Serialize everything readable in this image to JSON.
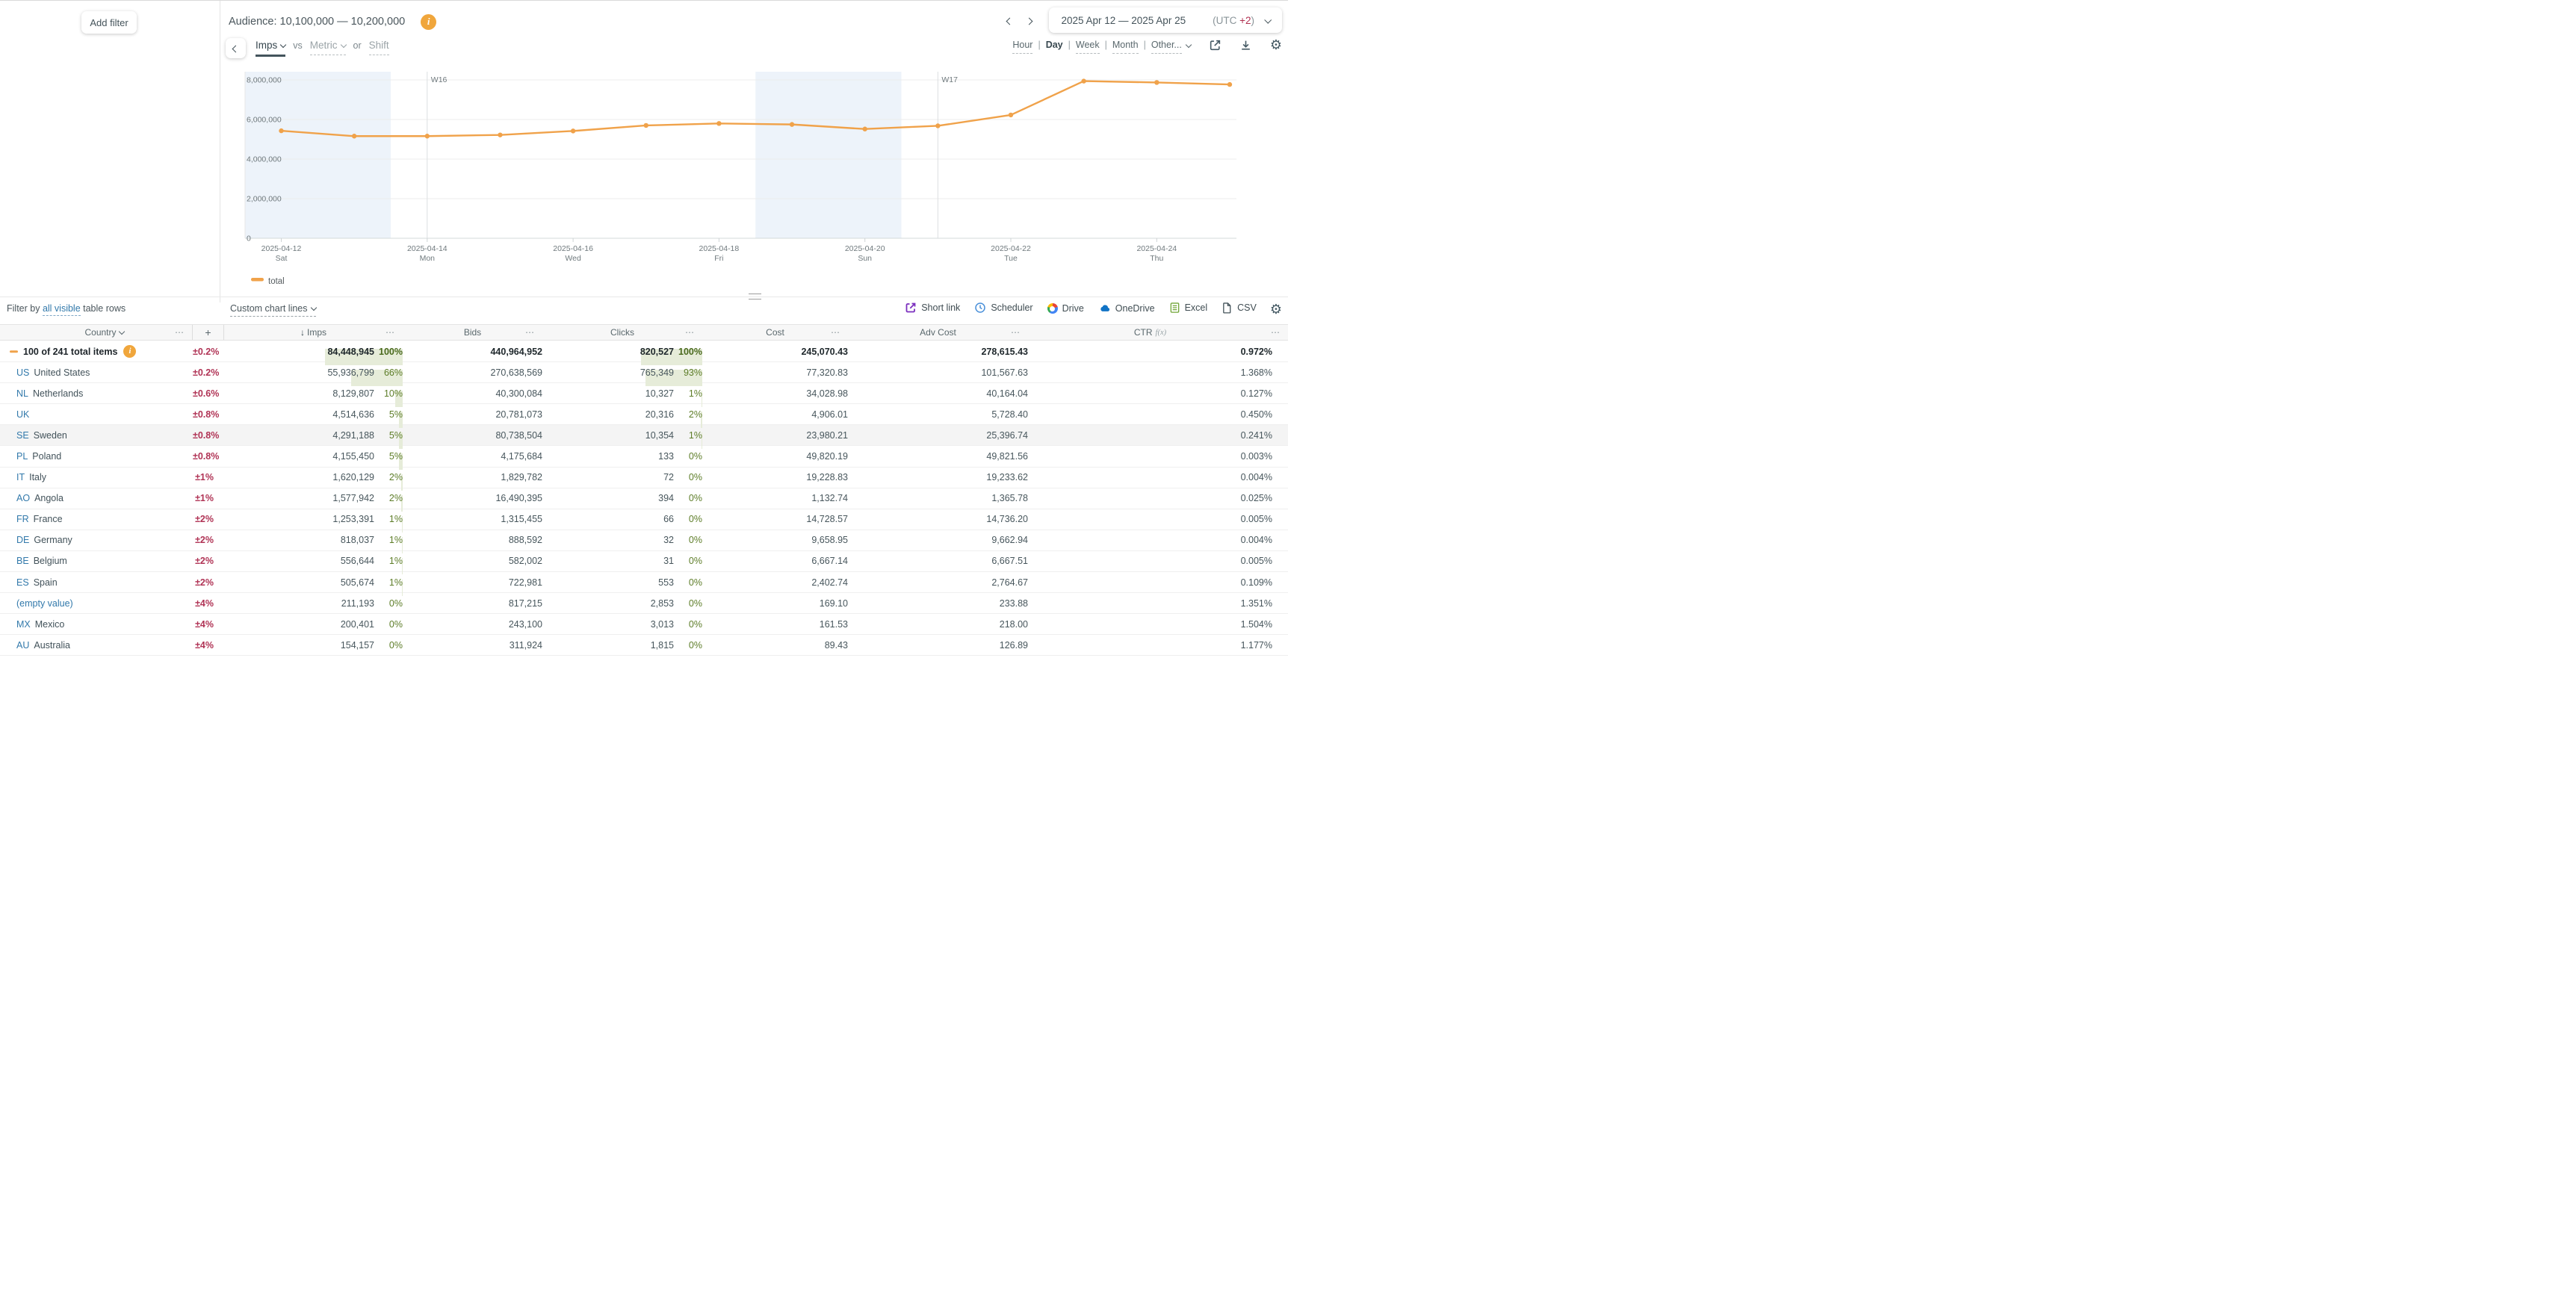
{
  "icons": {
    "ellipsis": "⋯",
    "plus": "+",
    "sort_desc": "↓",
    "gear": "⚙"
  },
  "header": {
    "add_filter_label": "Add filter",
    "audience_label": "Audience: 10,100,000 — 10,200,000",
    "date_range": "2025 Apr 12 — 2025 Apr 25",
    "utc_prefix": "(UTC ",
    "utc_value": "+2",
    "utc_suffix": ")"
  },
  "controls": {
    "primary_metric": "Imps",
    "vs_label": "vs",
    "secondary_metric": "Metric",
    "or_label": "or",
    "shift_label": "Shift",
    "granularities": [
      "Hour",
      "Day",
      "Week",
      "Month",
      "Other..."
    ],
    "selected_granularity": "Day"
  },
  "chart_data": {
    "type": "line",
    "x": [
      "2025-04-12",
      "2025-04-13",
      "2025-04-14",
      "2025-04-15",
      "2025-04-16",
      "2025-04-17",
      "2025-04-18",
      "2025-04-19",
      "2025-04-20",
      "2025-04-21",
      "2025-04-22",
      "2025-04-23",
      "2025-04-24",
      "2025-04-25"
    ],
    "series": [
      {
        "name": "total",
        "values": [
          5430000,
          5160000,
          5160000,
          5220000,
          5420000,
          5700000,
          5800000,
          5750000,
          5520000,
          5680000,
          6230000,
          7940000,
          7870000,
          7770000
        ]
      }
    ],
    "ylim": [
      0,
      8000000
    ],
    "y_ticks": [
      {
        "value": 0,
        "label": "0"
      },
      {
        "value": 2000000,
        "label": "2,000,000"
      },
      {
        "value": 4000000,
        "label": "4,000,000"
      },
      {
        "value": 6000000,
        "label": "6,000,000"
      },
      {
        "value": 8000000,
        "label": "8,000,000"
      }
    ],
    "x_tick_labels": [
      {
        "index": 0,
        "date": "2025-04-12",
        "weekday": "Sat"
      },
      {
        "index": 2,
        "date": "2025-04-14",
        "weekday": "Mon"
      },
      {
        "index": 4,
        "date": "2025-04-16",
        "weekday": "Wed"
      },
      {
        "index": 6,
        "date": "2025-04-18",
        "weekday": "Fri"
      },
      {
        "index": 8,
        "date": "2025-04-20",
        "weekday": "Sun"
      },
      {
        "index": 10,
        "date": "2025-04-22",
        "weekday": "Tue"
      },
      {
        "index": 12,
        "date": "2025-04-24",
        "weekday": "Thu"
      }
    ],
    "week_markers": [
      {
        "index": 2,
        "label": "W16"
      },
      {
        "index": 9,
        "label": "W17"
      }
    ],
    "weekend_bands": [
      [
        0,
        1
      ],
      [
        7,
        8
      ]
    ],
    "legend": [
      "total"
    ],
    "legend_position": "bottom-left",
    "grid": true,
    "line_color": "#f0a24a",
    "weekend_band_color": "#edf3fa"
  },
  "filter_row": {
    "filter_prefix": "Filter by ",
    "filter_link": "all visible",
    "filter_suffix": " table rows",
    "custom_chart_lines": "Custom chart lines"
  },
  "export_row": {
    "items": [
      {
        "label": "Short link",
        "icon": "short-link-icon"
      },
      {
        "label": "Scheduler",
        "icon": "scheduler-clock-icon"
      },
      {
        "label": "Drive",
        "icon": "google-drive-icon"
      },
      {
        "label": "OneDrive",
        "icon": "onedrive-cloud-icon"
      },
      {
        "label": "Excel",
        "icon": "excel-icon"
      },
      {
        "label": "CSV",
        "icon": "csv-icon"
      }
    ]
  },
  "table": {
    "columns": {
      "country": "Country",
      "imps": "Imps",
      "bids": "Bids",
      "clicks": "Clicks",
      "cost": "Cost",
      "adv_cost": "Adv Cost",
      "ctr": "CTR",
      "ctr_fn": "f(x)"
    },
    "rows": [
      {
        "code": "",
        "name": "100 of 241 total items",
        "is_total": true,
        "err": "±0.2%",
        "imps": "84,448,945",
        "imps_pct": "100%",
        "bids": "440,964,952",
        "clicks": "820,527",
        "clicks_pct": "100%",
        "cost": "245,070.43",
        "adv_cost": "278,615.43",
        "ctr": "0.972%"
      },
      {
        "code": "US",
        "name": "United States",
        "err": "±0.2%",
        "imps": "55,936,799",
        "imps_pct": "66%",
        "bids": "270,638,569",
        "clicks": "765,349",
        "clicks_pct": "93%",
        "cost": "77,320.83",
        "adv_cost": "101,567.63",
        "ctr": "1.368%"
      },
      {
        "code": "NL",
        "name": "Netherlands",
        "err": "±0.6%",
        "imps": "8,129,807",
        "imps_pct": "10%",
        "bids": "40,300,084",
        "clicks": "10,327",
        "clicks_pct": "1%",
        "cost": "34,028.98",
        "adv_cost": "40,164.04",
        "ctr": "0.127%"
      },
      {
        "code": "UK",
        "name": "",
        "err": "±0.8%",
        "imps": "4,514,636",
        "imps_pct": "5%",
        "bids": "20,781,073",
        "clicks": "20,316",
        "clicks_pct": "2%",
        "cost": "4,906.01",
        "adv_cost": "5,728.40",
        "ctr": "0.450%"
      },
      {
        "code": "SE",
        "name": "Sweden",
        "shaded": true,
        "err": "±0.8%",
        "imps": "4,291,188",
        "imps_pct": "5%",
        "bids": "80,738,504",
        "clicks": "10,354",
        "clicks_pct": "1%",
        "cost": "23,980.21",
        "adv_cost": "25,396.74",
        "ctr": "0.241%"
      },
      {
        "code": "PL",
        "name": "Poland",
        "err": "±0.8%",
        "imps": "4,155,450",
        "imps_pct": "5%",
        "bids": "4,175,684",
        "clicks": "133",
        "clicks_pct": "0%",
        "cost": "49,820.19",
        "adv_cost": "49,821.56",
        "ctr": "0.003%"
      },
      {
        "code": "IT",
        "name": "Italy",
        "err": "±1%",
        "imps": "1,620,129",
        "imps_pct": "2%",
        "bids": "1,829,782",
        "clicks": "72",
        "clicks_pct": "0%",
        "cost": "19,228.83",
        "adv_cost": "19,233.62",
        "ctr": "0.004%"
      },
      {
        "code": "AO",
        "name": "Angola",
        "err": "±1%",
        "imps": "1,577,942",
        "imps_pct": "2%",
        "bids": "16,490,395",
        "clicks": "394",
        "clicks_pct": "0%",
        "cost": "1,132.74",
        "adv_cost": "1,365.78",
        "ctr": "0.025%"
      },
      {
        "code": "FR",
        "name": "France",
        "err": "±2%",
        "imps": "1,253,391",
        "imps_pct": "1%",
        "bids": "1,315,455",
        "clicks": "66",
        "clicks_pct": "0%",
        "cost": "14,728.57",
        "adv_cost": "14,736.20",
        "ctr": "0.005%"
      },
      {
        "code": "DE",
        "name": "Germany",
        "err": "±2%",
        "imps": "818,037",
        "imps_pct": "1%",
        "bids": "888,592",
        "clicks": "32",
        "clicks_pct": "0%",
        "cost": "9,658.95",
        "adv_cost": "9,662.94",
        "ctr": "0.004%"
      },
      {
        "code": "BE",
        "name": "Belgium",
        "err": "±2%",
        "imps": "556,644",
        "imps_pct": "1%",
        "bids": "582,002",
        "clicks": "31",
        "clicks_pct": "0%",
        "cost": "6,667.14",
        "adv_cost": "6,667.51",
        "ctr": "0.005%"
      },
      {
        "code": "ES",
        "name": "Spain",
        "err": "±2%",
        "imps": "505,674",
        "imps_pct": "1%",
        "bids": "722,981",
        "clicks": "553",
        "clicks_pct": "0%",
        "cost": "2,402.74",
        "adv_cost": "2,764.67",
        "ctr": "0.109%"
      },
      {
        "code": "",
        "name": "(empty value)",
        "empty": true,
        "err": "±4%",
        "imps": "211,193",
        "imps_pct": "0%",
        "bids": "817,215",
        "clicks": "2,853",
        "clicks_pct": "0%",
        "cost": "169.10",
        "adv_cost": "233.88",
        "ctr": "1.351%"
      },
      {
        "code": "MX",
        "name": "Mexico",
        "err": "±4%",
        "imps": "200,401",
        "imps_pct": "0%",
        "bids": "243,100",
        "clicks": "3,013",
        "clicks_pct": "0%",
        "cost": "161.53",
        "adv_cost": "218.00",
        "ctr": "1.504%"
      },
      {
        "code": "AU",
        "name": "Australia",
        "err": "±4%",
        "imps": "154,157",
        "imps_pct": "0%",
        "bids": "311,924",
        "clicks": "1,815",
        "clicks_pct": "0%",
        "cost": "89.43",
        "adv_cost": "126.89",
        "ctr": "1.177%"
      }
    ]
  }
}
